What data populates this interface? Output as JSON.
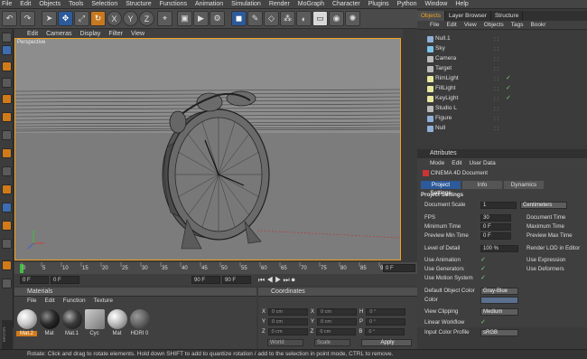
{
  "menubar": [
    "File",
    "Edit",
    "Objects",
    "Tools",
    "Selection",
    "Structure",
    "Functions",
    "Animation",
    "Simulation",
    "Render",
    "MoGraph",
    "Character",
    "Plugins",
    "Python",
    "Window",
    "Help"
  ],
  "toolbar_icons": [
    "undo-icon",
    "redo-icon",
    "live-select-icon",
    "move-icon",
    "scale-icon",
    "rotate-icon",
    "x-axis",
    "y-axis",
    "z-axis",
    "coordinate-system-icon",
    "render-region-icon",
    "render-view-icon",
    "render-settings-icon",
    "cube-icon",
    "pen-icon",
    "subdivision-icon",
    "array-icon",
    "deformer-icon",
    "floor-icon",
    "camera-icon",
    "light-icon"
  ],
  "toolbar_axes": [
    "X",
    "Y",
    "Z"
  ],
  "viewport": {
    "menu": [
      "Edit",
      "Cameras",
      "Display",
      "Filter",
      "View"
    ],
    "label": "Perspective"
  },
  "timeline": {
    "ticks": [
      "0",
      "5",
      "10",
      "15",
      "20",
      "25",
      "30",
      "35",
      "40",
      "45",
      "50",
      "55",
      "60",
      "65",
      "70",
      "75",
      "80",
      "85",
      "90"
    ],
    "frame_end": "0 F",
    "start_field": "0 F",
    "cur_field": "0 F",
    "end_field": "90 F",
    "max_field": "90 F"
  },
  "materials": {
    "title": "Materials",
    "menu": [
      "File",
      "Edit",
      "Function",
      "Texture"
    ],
    "items": [
      {
        "label": "Mat.2",
        "color": "#c8c8c8",
        "selected": true
      },
      {
        "label": "Mat",
        "color": "#2a2a2a",
        "selected": false
      },
      {
        "label": "Mat.1",
        "color": "#3a3a3a",
        "selected": false
      },
      {
        "label": "Cyc",
        "color": "#aaa",
        "selected": false
      },
      {
        "label": "Mat",
        "color": "#bbb",
        "selected": false
      },
      {
        "label": "HDRI 0",
        "color": "#666",
        "selected": false
      }
    ]
  },
  "coordinates": {
    "title": "Coordinates",
    "rows": [
      {
        "a": "X",
        "av": "0 cm",
        "b": "X",
        "bv": "0 cm",
        "c": "H",
        "cv": "0 °"
      },
      {
        "a": "Y",
        "av": "0 cm",
        "b": "Y",
        "bv": "0 cm",
        "c": "P",
        "cv": "0 °"
      },
      {
        "a": "Z",
        "av": "0 cm",
        "b": "Z",
        "bv": "0 cm",
        "c": "B",
        "cv": "0 °"
      }
    ],
    "mode1": "World",
    "mode2": "Scale",
    "apply": "Apply"
  },
  "objects": {
    "tabs": [
      "Objects",
      "Layer Browser",
      "Structure"
    ],
    "menu": [
      "File",
      "Edit",
      "View",
      "Objects",
      "Tags",
      "Bookr"
    ],
    "list": [
      {
        "name": "Null.1",
        "check": "",
        "icon": "#8fb0d8"
      },
      {
        "name": "Sky",
        "check": "",
        "icon": "#7cc4e8"
      },
      {
        "name": "Camera",
        "check": "",
        "icon": "#bbb"
      },
      {
        "name": "Target",
        "check": "",
        "icon": "#bbb"
      },
      {
        "name": "RimLight",
        "check": "✓",
        "icon": "#e8e8a0"
      },
      {
        "name": "FillLight",
        "check": "✓",
        "icon": "#e8e8a0"
      },
      {
        "name": "KeyLight",
        "check": "✓",
        "icon": "#e8e8a0"
      },
      {
        "name": "Studio L",
        "check": "",
        "icon": "#bbb"
      },
      {
        "name": "Figure",
        "check": "",
        "icon": "#8fb0d8"
      },
      {
        "name": "Null",
        "check": "",
        "icon": "#8fb0d8"
      }
    ]
  },
  "attributes": {
    "title": "Attributes",
    "menu": [
      "Mode",
      "Edit",
      "User Data"
    ],
    "doc_title": "CINEMA 4D Document",
    "tabs": [
      "Project Settings",
      "Info",
      "Dynamics"
    ],
    "section": "Project Settings",
    "doc_scale_label": "Document Scale",
    "doc_scale_value": "1",
    "doc_scale_unit": "Centimeters",
    "fps_label": "FPS",
    "fps_value": "30",
    "min_time_label": "Minimum Time",
    "min_time_value": "0 F",
    "prev_min_label": "Preview Min Time",
    "prev_min_value": "0 F",
    "doc_time_label": "Document Time",
    "max_time_label": "Maximum Time",
    "prev_max_label": "Preview Max Time",
    "lod_label": "Level of Detail",
    "lod_value": "100 %",
    "render_lod_label": "Render LOD in Editor",
    "use_anim_label": "Use Animation",
    "use_expr_label": "Use Expression",
    "use_gen_label": "Use Generators",
    "use_def_label": "Use Deformers",
    "use_motion_label": "Use Motion System",
    "def_color_label": "Default Object Color",
    "def_color_value": "Gray-Blue",
    "color_label": "Color",
    "clipping_label": "View Clipping",
    "clipping_value": "Medium",
    "linear_label": "Linear Workflow",
    "input_profile_label": "Input Color Profile",
    "input_profile_value": "sRGB"
  },
  "status": "Rotate: Click and drag to rotate elements. Hold down SHIFT to add to quantize rotation / add to the selection in point mode, CTRL to remove."
}
